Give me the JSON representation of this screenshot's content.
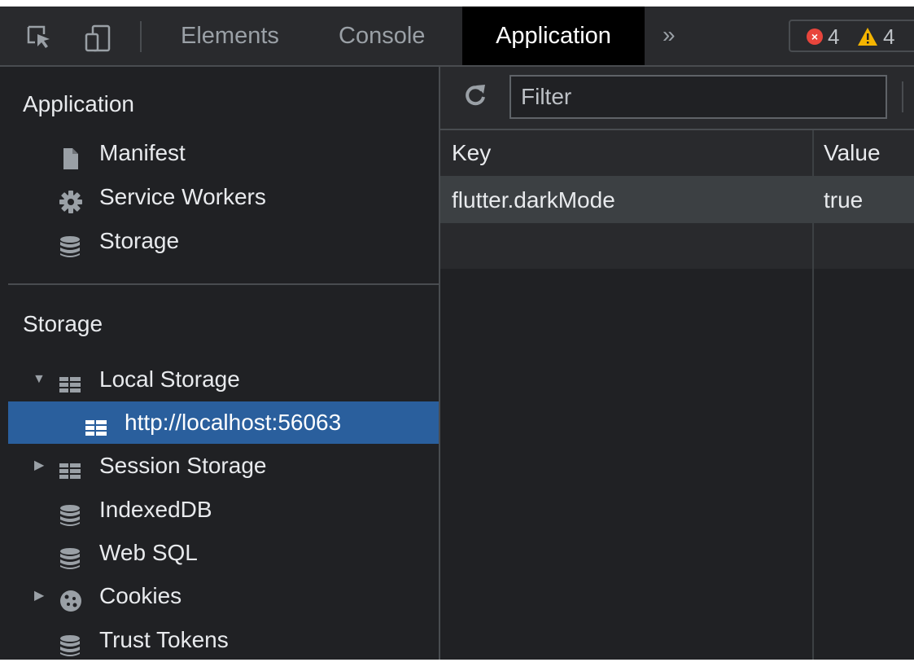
{
  "toolbar": {
    "tabs": [
      {
        "label": "Elements"
      },
      {
        "label": "Console"
      },
      {
        "label": "Application"
      }
    ],
    "more_icon": "chevron-double-right-icon",
    "errors_count": "4",
    "warnings_count": "4"
  },
  "sidebar": {
    "application_section": {
      "title": "Application",
      "items": [
        {
          "label": "Manifest",
          "icon": "file-icon"
        },
        {
          "label": "Service Workers",
          "icon": "gear-icon"
        },
        {
          "label": "Storage",
          "icon": "database-icon"
        }
      ]
    },
    "storage_section": {
      "title": "Storage",
      "items": [
        {
          "label": "Local Storage",
          "icon": "table-icon",
          "expanded": true
        },
        {
          "label": "http://localhost:56063",
          "icon": "table-icon",
          "selected": true
        },
        {
          "label": "Session Storage",
          "icon": "table-icon",
          "expanded": false
        },
        {
          "label": "IndexedDB",
          "icon": "database-icon"
        },
        {
          "label": "Web SQL",
          "icon": "database-icon"
        },
        {
          "label": "Cookies",
          "icon": "cookie-icon",
          "expanded": false
        },
        {
          "label": "Trust Tokens",
          "icon": "database-icon"
        }
      ]
    }
  },
  "main": {
    "filter": {
      "placeholder": "Filter",
      "value": ""
    },
    "table": {
      "columns": [
        "Key",
        "Value"
      ],
      "rows": [
        {
          "key": "flutter.darkMode",
          "value": "true"
        }
      ]
    }
  },
  "colors": {
    "background": "#202124",
    "toolbar": "#292a2d",
    "selected_sidebar": "#2a5f9d",
    "error": "#e8453c",
    "warning": "#f4b400"
  }
}
